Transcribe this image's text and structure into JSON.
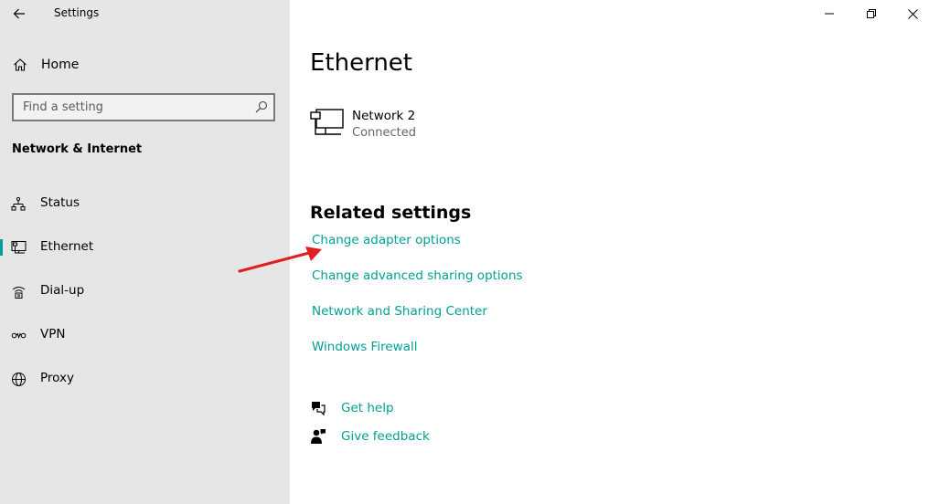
{
  "app": {
    "title": "Settings"
  },
  "sidebar": {
    "home_label": "Home",
    "search_placeholder": "Find a setting",
    "section_title": "Network & Internet",
    "items": [
      {
        "label": "Status",
        "icon": "status-icon",
        "selected": false
      },
      {
        "label": "Ethernet",
        "icon": "ethernet-icon",
        "selected": true
      },
      {
        "label": "Dial-up",
        "icon": "dialup-icon",
        "selected": false
      },
      {
        "label": "VPN",
        "icon": "vpn-icon",
        "selected": false
      },
      {
        "label": "Proxy",
        "icon": "proxy-icon",
        "selected": false
      }
    ]
  },
  "main": {
    "title": "Ethernet",
    "network": {
      "name": "Network 2",
      "status": "Connected"
    },
    "related": {
      "title": "Related settings",
      "links": [
        "Change adapter options",
        "Change advanced sharing options",
        "Network and Sharing Center",
        "Windows Firewall"
      ]
    },
    "help": {
      "get_help": "Get help",
      "give_feedback": "Give feedback"
    }
  },
  "colors": {
    "accent": "#00a094",
    "sidebar_bg": "#e6e6e6",
    "annotation_arrow": "#e02020"
  }
}
